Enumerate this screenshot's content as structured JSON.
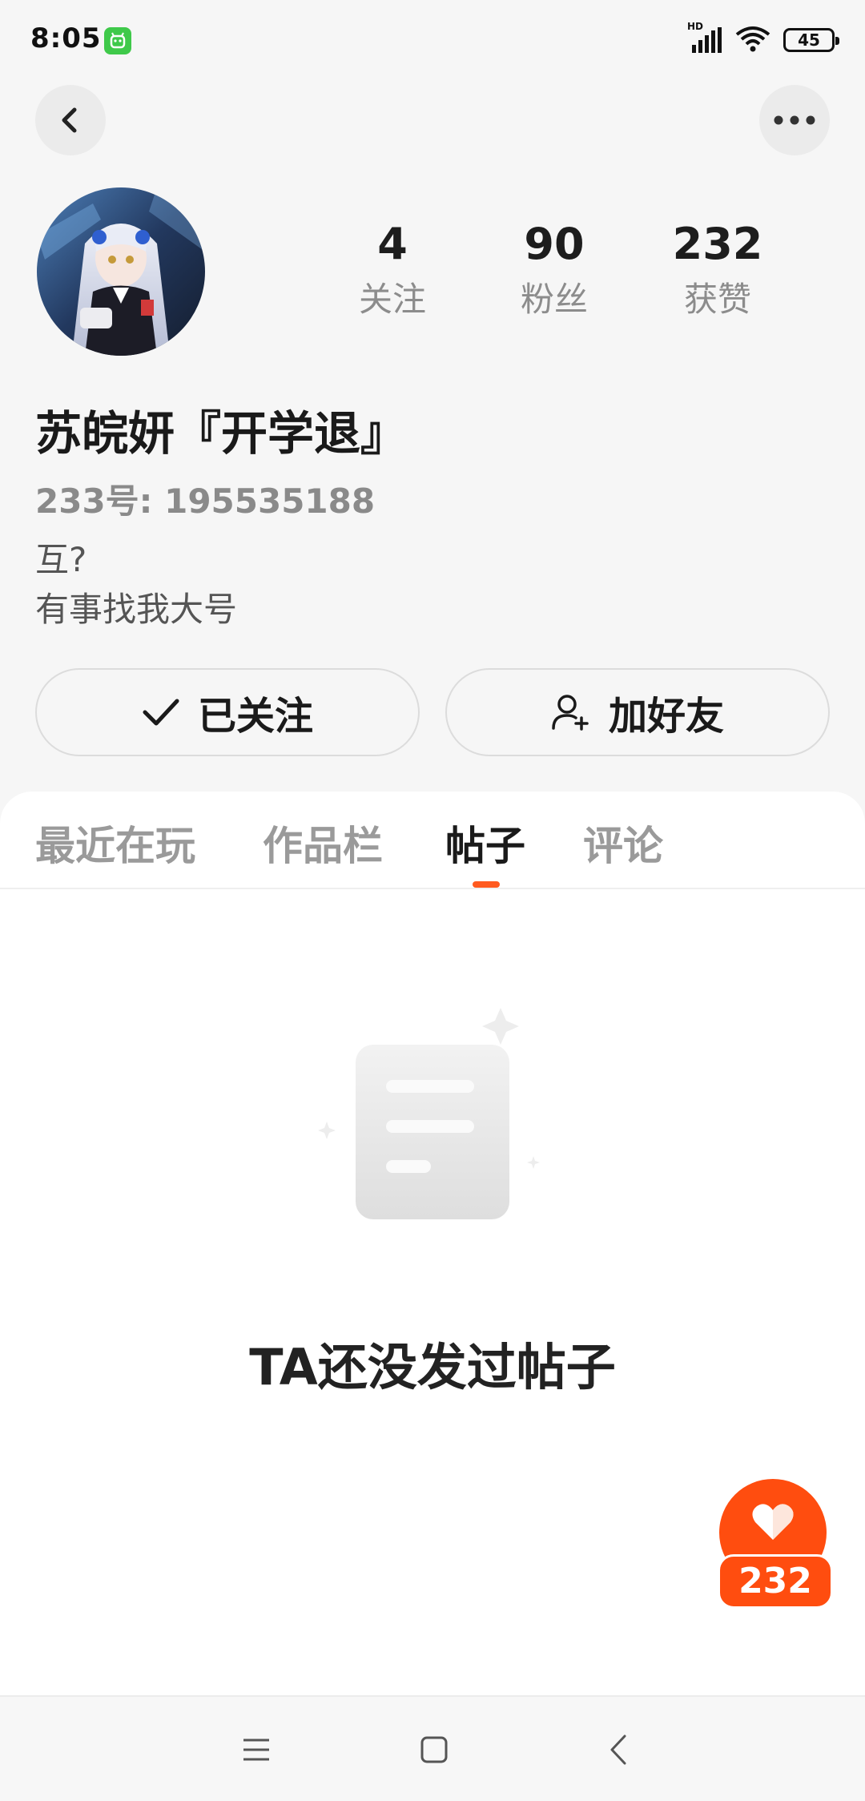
{
  "status_bar": {
    "time": "8:05",
    "network_label": "HD",
    "battery": "45",
    "icons": [
      "app-notification-icon",
      "signal-icon",
      "wifi-icon",
      "battery-icon"
    ]
  },
  "nav": {
    "back_icon": "chevron-left-icon",
    "more_icon": "more-dots-icon"
  },
  "profile": {
    "stats": [
      {
        "value": "4",
        "label": "关注"
      },
      {
        "value": "90",
        "label": "粉丝"
      },
      {
        "value": "232",
        "label": "获赞"
      }
    ],
    "username": "苏皖妍『开学退』",
    "uid": "233号: 195535188",
    "bio": [
      "互?",
      "有事找我大号"
    ]
  },
  "actions": {
    "follow_label": "已关注",
    "add_friend_label": "加好友"
  },
  "tabs": [
    "最近在玩",
    "作品栏",
    "帖子",
    "评论"
  ],
  "active_tab": "帖子",
  "empty_state": {
    "message": "TA还没发过帖子"
  },
  "like_fab": {
    "count": "232"
  },
  "colors": {
    "accent": "#ff4d0f",
    "background": "#f6f6f6",
    "card": "#ffffff",
    "muted_text": "#9a9a9a"
  }
}
